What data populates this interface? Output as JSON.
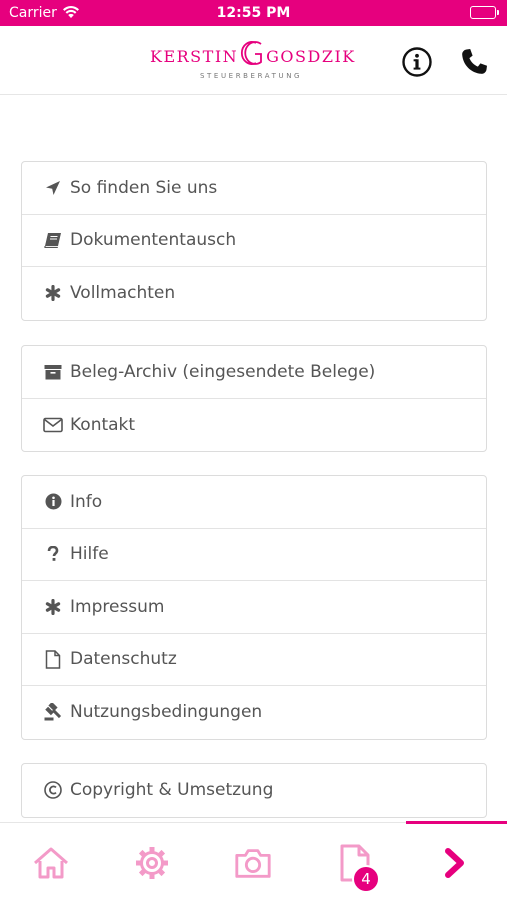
{
  "status_bar": {
    "carrier": "Carrier",
    "time": "12:55 PM",
    "battery_level": 1.0
  },
  "header": {
    "logo": {
      "name_left": "KERSTIN",
      "name_right": "GOSDZIK",
      "monogram": "KG",
      "subtitle": "STEUERBERATUNG"
    },
    "info_icon": "info-circle-icon",
    "phone_icon": "phone-icon"
  },
  "menu": {
    "groups": [
      {
        "items": [
          {
            "label": "So finden Sie uns",
            "icon": "location-arrow-icon"
          },
          {
            "label": "Dokumententausch",
            "icon": "book-icon"
          },
          {
            "label": "Vollmachten",
            "icon": "asterisk-icon"
          }
        ]
      },
      {
        "items": [
          {
            "label": "Beleg-Archiv (eingesendete Belege)",
            "icon": "archive-icon"
          },
          {
            "label": "Kontakt",
            "icon": "envelope-icon"
          }
        ]
      },
      {
        "items": [
          {
            "label": "Info",
            "icon": "info-icon"
          },
          {
            "label": "Hilfe",
            "icon": "question-icon"
          },
          {
            "label": "Impressum",
            "icon": "asterisk-icon"
          },
          {
            "label": "Datenschutz",
            "icon": "file-icon"
          },
          {
            "label": "Nutzungsbedingungen",
            "icon": "gavel-icon"
          }
        ]
      },
      {
        "items": [
          {
            "label": "Copyright & Umsetzung",
            "icon": "copyright-icon"
          }
        ]
      }
    ]
  },
  "tab_bar": {
    "tabs": [
      {
        "icon": "home-icon"
      },
      {
        "icon": "gear-icon"
      },
      {
        "icon": "camera-icon"
      },
      {
        "icon": "document-icon",
        "badge": "4"
      },
      {
        "icon": "chevron-right-icon",
        "active": true
      }
    ]
  },
  "colors": {
    "accent": "#e6007e",
    "text": "#555555",
    "border": "#dcdcdc"
  }
}
